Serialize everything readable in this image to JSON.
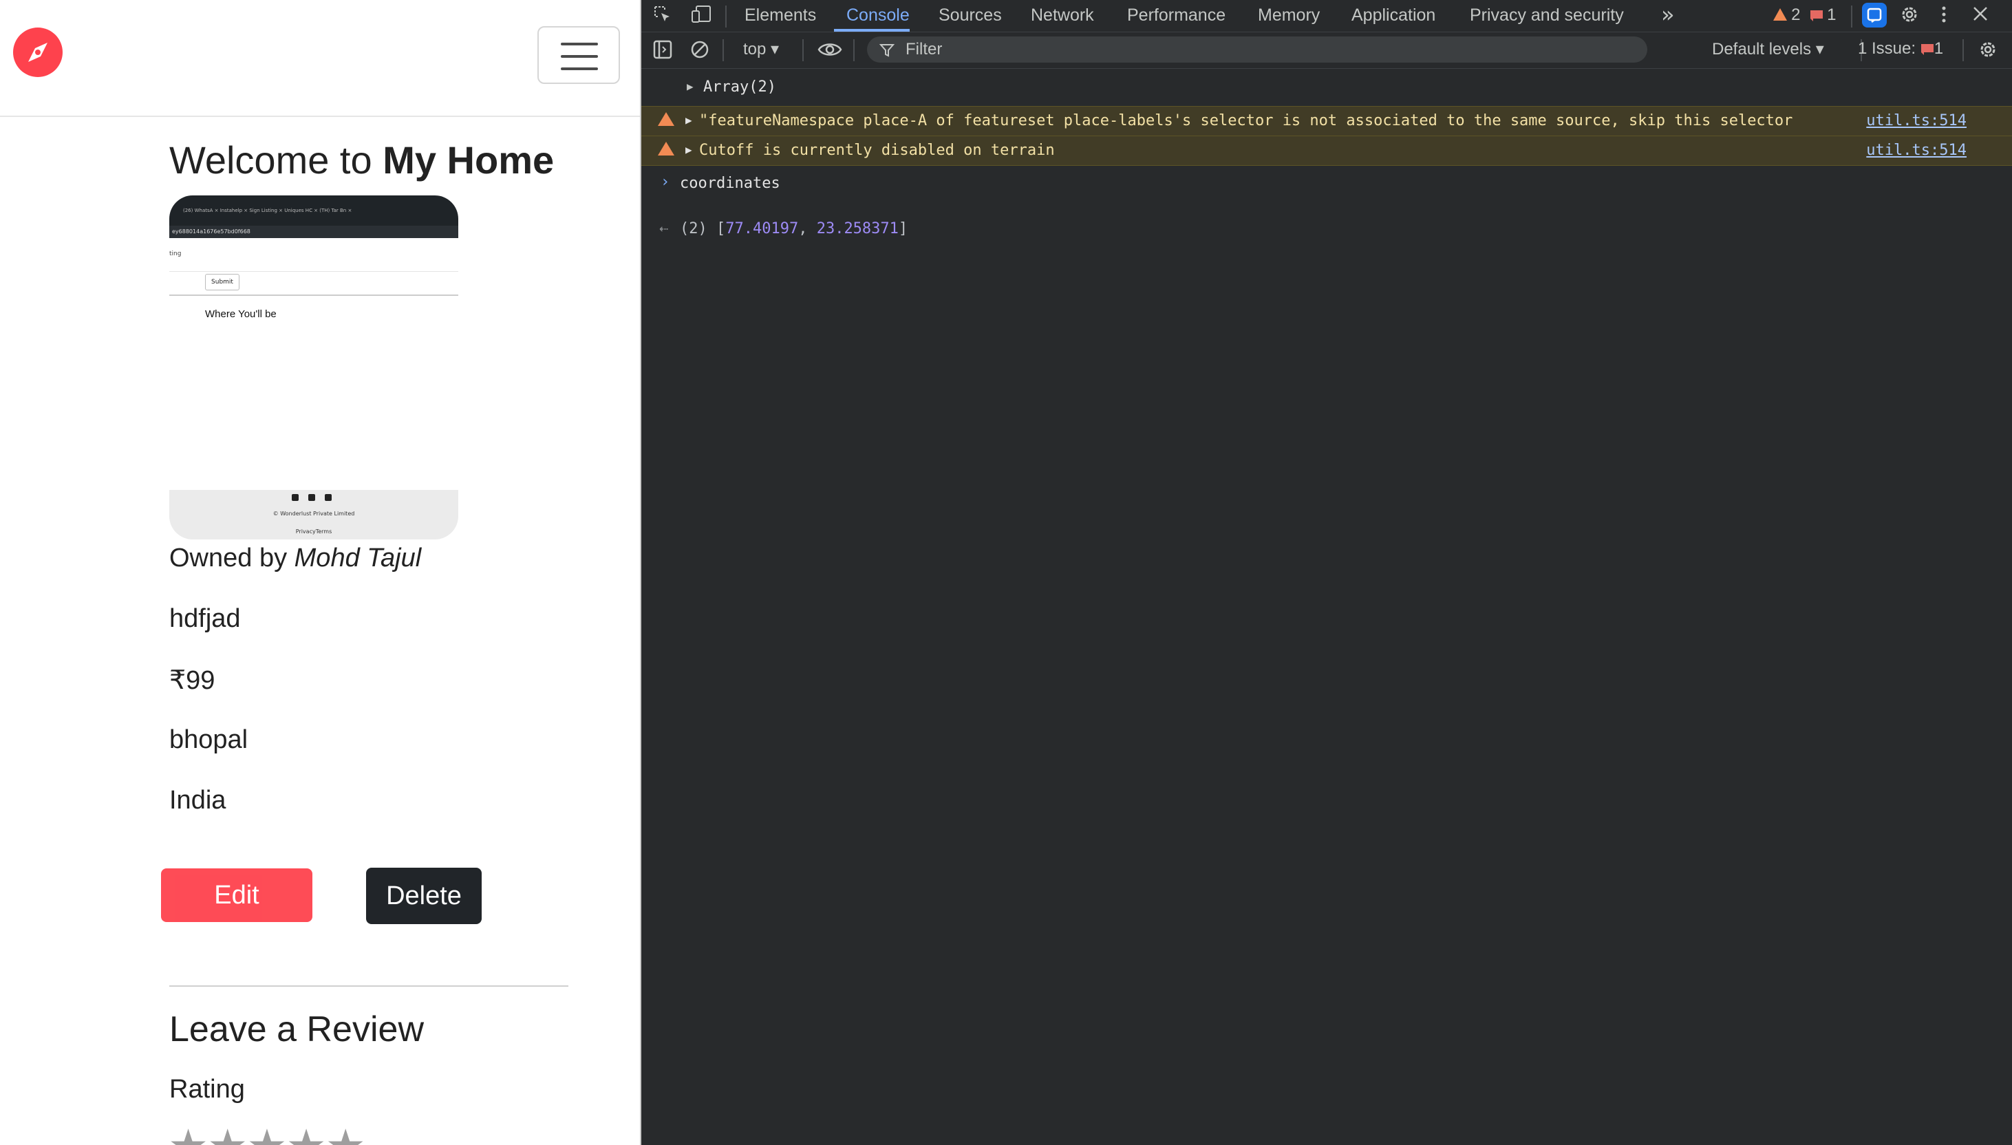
{
  "app": {
    "title_prefix": "Welcome to ",
    "title_bold": "My Home",
    "thumbnail": {
      "tabs_text": "(26) WhatsA  ×   Instahelp ×   Sign Listing ×   Uniques HC ×   (TH) Tar Bn ×",
      "url_text": "ey688014a1676e57bd0f668",
      "left_text": "ting",
      "submit_label": "Submit",
      "where_label": "Where You'll be",
      "copyright": "© Wonderlust Private Limited",
      "privacy_terms": "PrivacyTerms"
    },
    "owned_by_prefix": "Owned by ",
    "owner_name": "Mohd Tajul",
    "description": "hdfjad",
    "price": "₹99",
    "location": "bhopal",
    "country": "India",
    "edit_label": "Edit",
    "delete_label": "Delete",
    "review_heading": "Leave a Review",
    "rating_label": "Rating",
    "stars": "★★★★★",
    "brand_color": "#fe424d"
  },
  "devtools": {
    "tabs": [
      "Elements",
      "Console",
      "Sources",
      "Network",
      "Performance",
      "Memory",
      "Application",
      "Privacy and security"
    ],
    "active_tab": "Console",
    "more_tabs": "»",
    "warning_count": "2",
    "error_count": "1",
    "context": "top",
    "filter_placeholder": "Filter",
    "levels": "Default levels",
    "issues": "1 Issue:",
    "issues_count": "1",
    "console": {
      "array_line": "Array(2)",
      "warn1_text": "\"featureNamespace place-A of featureset place-labels's selector is not associated to the same source, skip this selector",
      "warn1_link": "util.ts:514",
      "warn2_text": "Cutoff is currently disabled on terrain",
      "warn2_link": "util.ts:514",
      "input_line": "coordinates",
      "result_prefix": "(2) [",
      "result_v1": "77.40197",
      "result_sep": ", ",
      "result_v2": "23.258371",
      "result_suffix": "]"
    }
  }
}
